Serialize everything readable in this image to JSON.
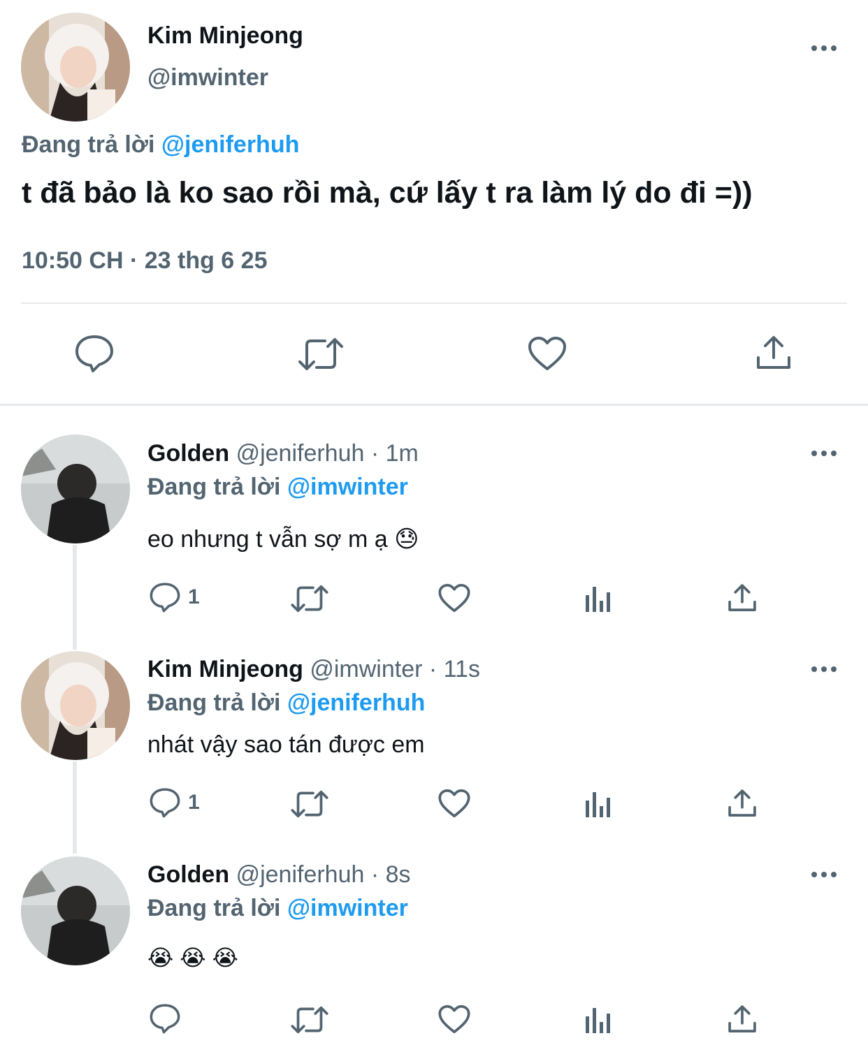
{
  "main_tweet": {
    "name": "Kim Minjeong",
    "handle": "@imwinter",
    "replying_prefix": "Đang trả lời",
    "replying_to": "@jeniferhuh",
    "text": "t đã bảo là ko sao rồi mà, cứ lấy t ra làm lý do đi =))",
    "timestamp": "10:50 CH · 23 thg 6 25"
  },
  "replies": [
    {
      "name": "Golden",
      "handle": "@jeniferhuh",
      "time": "· 1m",
      "replying_prefix": "Đang trả lời",
      "replying_to": "@imwinter",
      "text": "eo nhưng t vẫn sợ m ạ",
      "emoji": "😓",
      "reply_count": "1"
    },
    {
      "name": "Kim Minjeong",
      "handle": "@imwinter",
      "time": "· 11s",
      "replying_prefix": "Đang trả lời",
      "replying_to": "@jeniferhuh",
      "text": "nhát vậy sao tán được em",
      "reply_count": "1"
    },
    {
      "name": "Golden",
      "handle": "@jeniferhuh",
      "time": "· 8s",
      "replying_prefix": "Đang trả lời",
      "replying_to": "@imwinter",
      "text": "😭 😭 😭",
      "reply_count": ""
    }
  ],
  "icons": [
    "reply-icon",
    "retweet-icon",
    "like-icon",
    "views-icon",
    "share-icon",
    "more-icon"
  ],
  "colors": {
    "text": "#0f1419",
    "secondary": "#536471",
    "accent": "#1d9bf0",
    "divider": "#e6e9eb"
  }
}
